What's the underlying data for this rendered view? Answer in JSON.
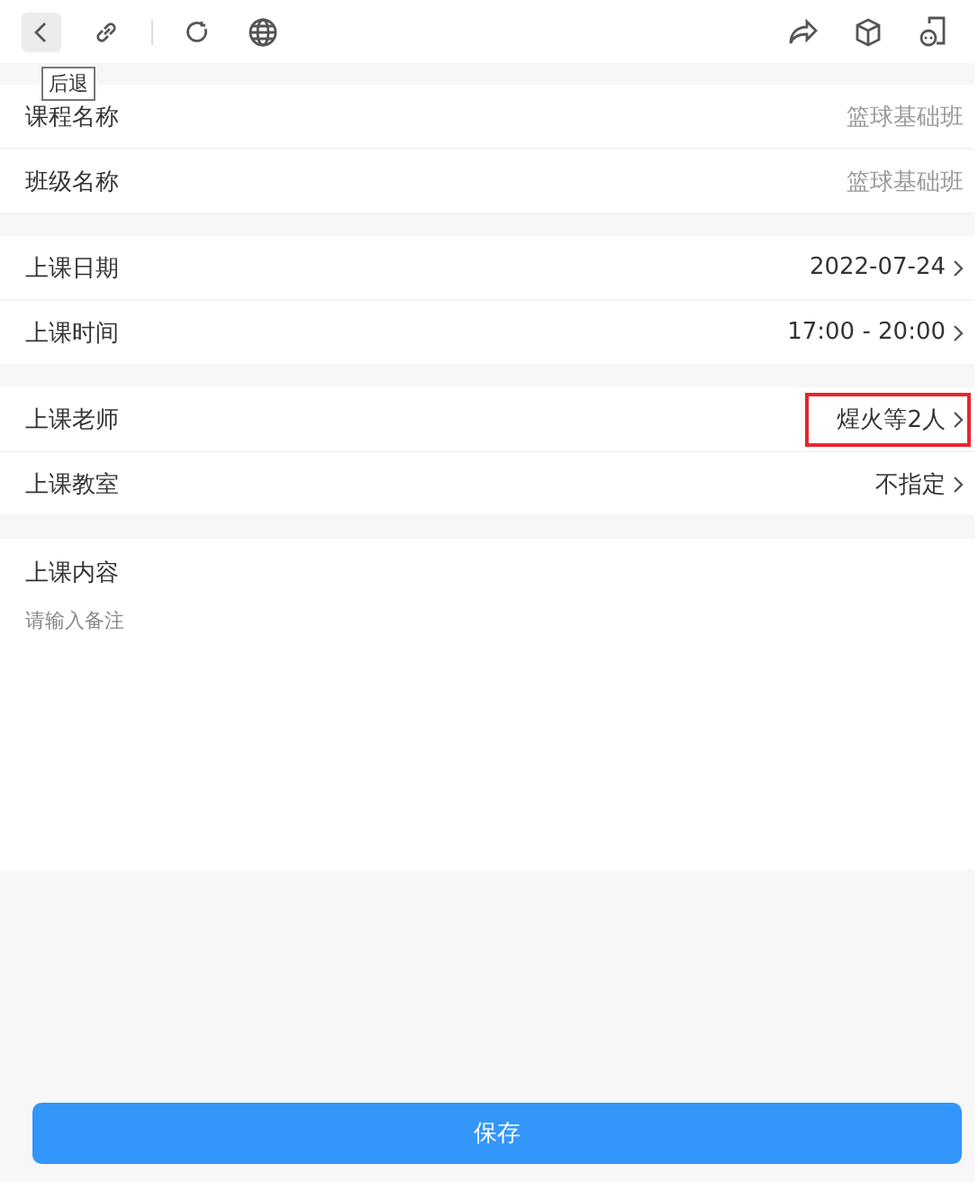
{
  "toolbar": {
    "tooltip": "后退"
  },
  "groups": [
    {
      "rows": [
        {
          "label": "课程名称",
          "value": "篮球基础班",
          "kind": "static",
          "highlighted": false
        },
        {
          "label": "班级名称",
          "value": "篮球基础班",
          "kind": "static",
          "highlighted": false
        }
      ]
    },
    {
      "rows": [
        {
          "label": "上课日期",
          "value": "2022-07-24",
          "kind": "link",
          "highlighted": false
        },
        {
          "label": "上课时间",
          "value": "17:00 - 20:00",
          "kind": "link",
          "highlighted": false
        }
      ]
    },
    {
      "rows": [
        {
          "label": "上课老师",
          "value": "煋火等2人",
          "kind": "link",
          "highlighted": true
        },
        {
          "label": "上课教室",
          "value": "不指定",
          "kind": "link",
          "highlighted": false
        }
      ]
    }
  ],
  "content": {
    "label": "上课内容",
    "placeholder": "请输入备注"
  },
  "save_button": "保存"
}
